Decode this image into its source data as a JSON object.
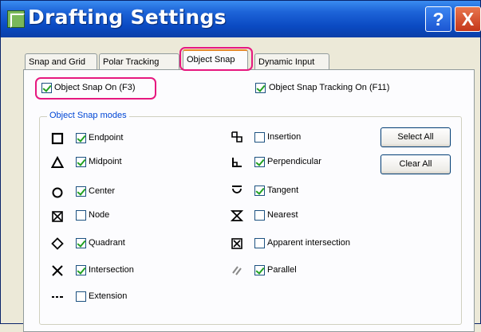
{
  "window": {
    "title": "Drafting Settings",
    "help_label": "?",
    "close_label": "X"
  },
  "tabs": [
    {
      "label": "Snap and Grid",
      "active": false
    },
    {
      "label": "Polar Tracking",
      "active": false
    },
    {
      "label": "Object Snap",
      "active": true
    },
    {
      "label": "Dynamic Input",
      "active": false
    }
  ],
  "snap_on": {
    "label": "Object Snap On (F3)",
    "checked": true
  },
  "tracking_on": {
    "label": "Object Snap Tracking On (F11)",
    "checked": true
  },
  "modes": {
    "group_title": "Object Snap modes",
    "left": [
      {
        "label": "Endpoint",
        "checked": true,
        "icon": "endpoint-icon"
      },
      {
        "label": "Midpoint",
        "checked": true,
        "icon": "midpoint-icon"
      },
      {
        "label": "Center",
        "checked": true,
        "icon": "center-icon"
      },
      {
        "label": "Node",
        "checked": false,
        "icon": "node-icon"
      },
      {
        "label": "Quadrant",
        "checked": true,
        "icon": "quadrant-icon"
      },
      {
        "label": "Intersection",
        "checked": true,
        "icon": "intersection-icon"
      },
      {
        "label": "Extension",
        "checked": false,
        "icon": "extension-icon"
      }
    ],
    "right": [
      {
        "label": "Insertion",
        "checked": false,
        "icon": "insertion-icon"
      },
      {
        "label": "Perpendicular",
        "checked": true,
        "icon": "perpendicular-icon"
      },
      {
        "label": "Tangent",
        "checked": true,
        "icon": "tangent-icon"
      },
      {
        "label": "Nearest",
        "checked": false,
        "icon": "nearest-icon"
      },
      {
        "label": "Apparent intersection",
        "checked": false,
        "icon": "apparent-intersection-icon"
      },
      {
        "label": "Parallel",
        "checked": true,
        "icon": "parallel-icon"
      }
    ]
  },
  "buttons": {
    "select_all": "Select All",
    "clear_all": "Clear All"
  },
  "colors": {
    "highlight": "#e6187f",
    "title_bar": "#0a4ac2",
    "group_title": "#0046d5"
  }
}
